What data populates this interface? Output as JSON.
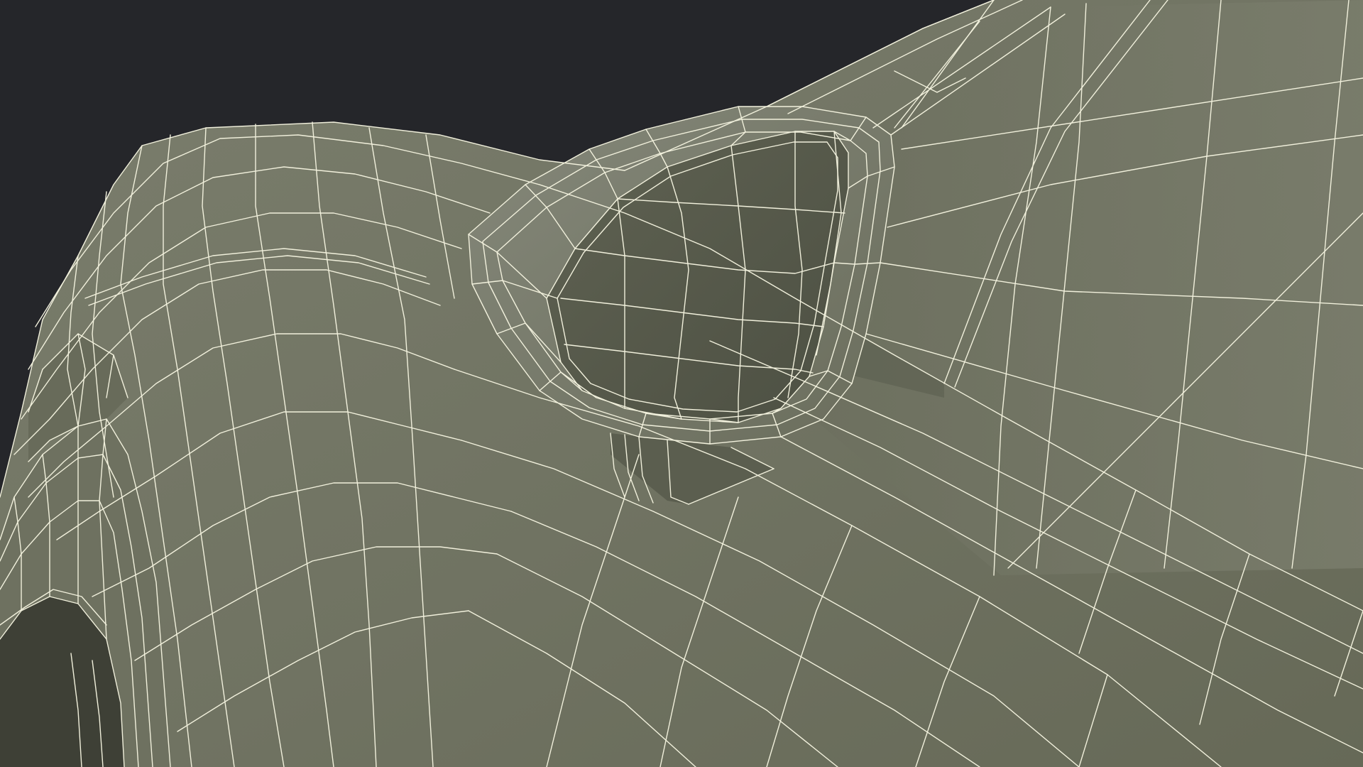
{
  "scene": {
    "background_color": "#25262a",
    "surface_color": "#747766",
    "surface_shadow_color": "#5a5c4e",
    "wireframe_color": "#f1f0dc"
  }
}
